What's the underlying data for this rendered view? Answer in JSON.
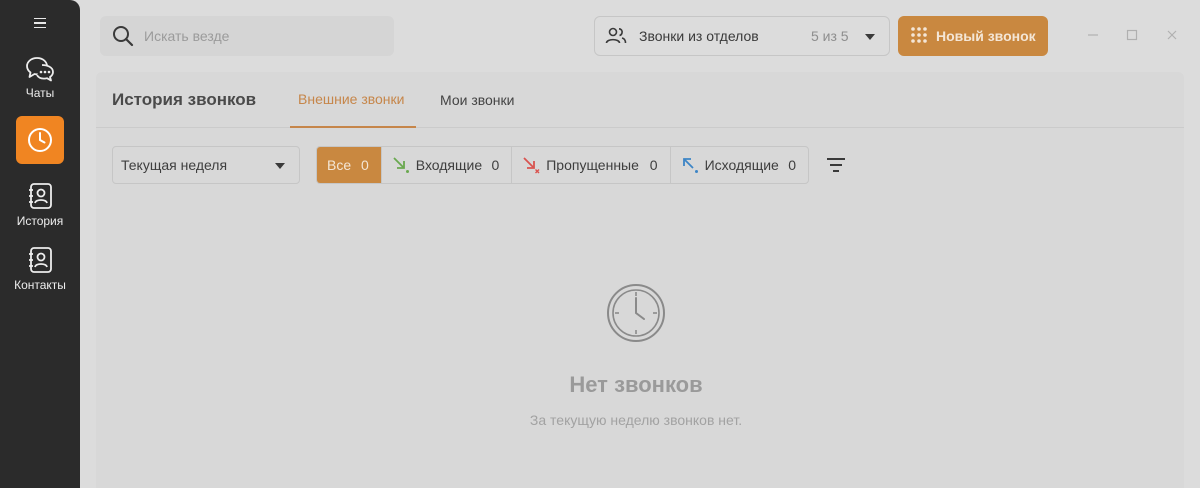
{
  "sidebar": {
    "items": [
      {
        "label": "Чаты",
        "icon": "chat-bubbles-icon"
      },
      {
        "label": "",
        "icon": "clock-icon"
      },
      {
        "label": "История",
        "icon": "history-contact-icon"
      },
      {
        "label": "Контакты",
        "icon": "contacts-icon"
      }
    ]
  },
  "search": {
    "placeholder": "Искать везде"
  },
  "departments": {
    "label": "Звонки из отделов",
    "count": "5 из 5"
  },
  "new_call": {
    "label": "Новый звонок"
  },
  "panel": {
    "title": "История звонков",
    "tabs": [
      {
        "label": "Внешние звонки",
        "active": true
      },
      {
        "label": "Мои звонки",
        "active": false
      }
    ],
    "period": {
      "value": "Текущая неделя"
    },
    "filters": [
      {
        "label": "Все",
        "count": "0",
        "active": true
      },
      {
        "label": "Входящие",
        "count": "0",
        "color": "#6aa84f"
      },
      {
        "label": "Пропущенные",
        "count": "0",
        "color": "#d9534f"
      },
      {
        "label": "Исходящие",
        "count": "0",
        "color": "#3d85c6"
      }
    ],
    "empty": {
      "title": "Нет звонков",
      "subtitle": "За текущую неделю звонков нет."
    }
  },
  "colors": {
    "accent": "#f08522",
    "sidebar": "#2b2b2b"
  }
}
